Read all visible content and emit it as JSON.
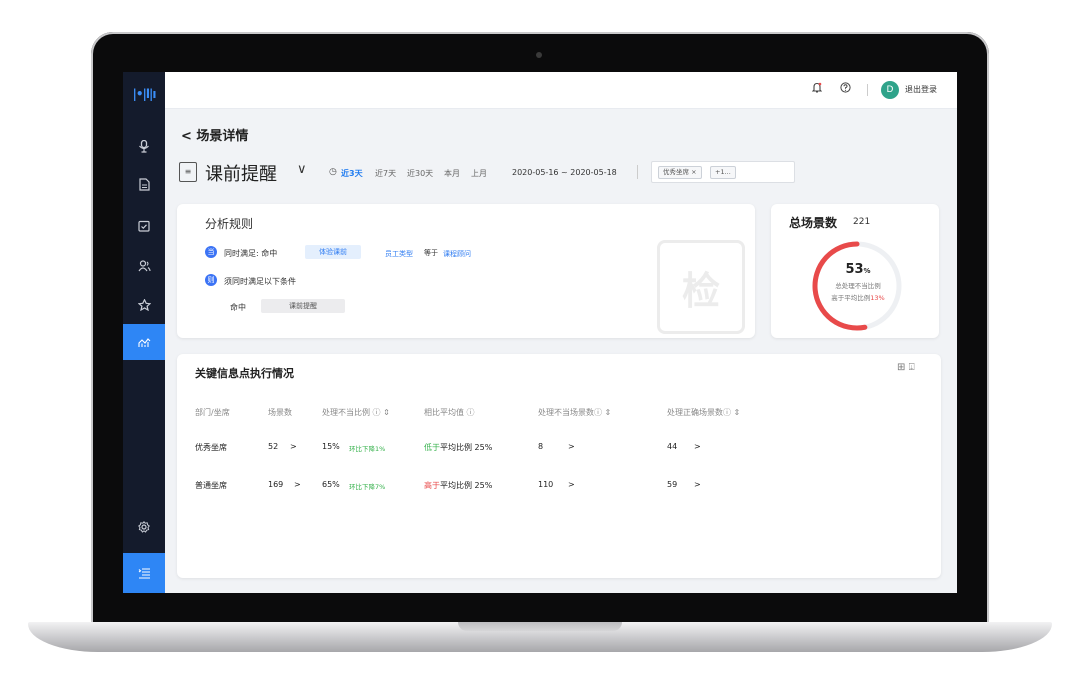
{
  "sidebar": {
    "logo": "|•|l|ı",
    "icons": [
      "microphone-icon",
      "document-icon",
      "calendar-check-icon",
      "users-icon",
      "star-icon",
      "analytics-icon",
      "settings-icon",
      "menu-list-icon"
    ]
  },
  "topbar": {
    "avatar_initial": "D",
    "logout_label": "退出登录"
  },
  "page": {
    "back_label": "场景详情",
    "title": "课前提醒",
    "ranges": [
      "近3天",
      "近7天",
      "近30天",
      "本月",
      "上月"
    ],
    "active_range": "近3天",
    "date_range": "2020-05-16 ~ 2020-05-18",
    "tags": [
      "优秀坐席 ×",
      "+1..."
    ]
  },
  "rules": {
    "title": "分析规则",
    "badge1": "当",
    "line1_text": "同时满足: 命中",
    "line1_pill": "体验课前",
    "line1_field": "员工类型",
    "line1_op": "等于",
    "line1_value": "课程顾问",
    "badge2": "则",
    "line2_text": "须同时满足以下条件",
    "line3_label": "命中",
    "line3_pill": "课前提醒",
    "stamp_char": "检"
  },
  "total": {
    "title": "总场景数",
    "count": "221",
    "percent": "53",
    "percent_unit": "%",
    "line1": "总处理不当比例",
    "line2_prefix": "高于平均比例",
    "line2_value": "13%"
  },
  "table": {
    "title": "关键信息点执行情况",
    "headers": [
      "部门/坐席",
      "场景数",
      "处理不当比例 ⓘ ⇕",
      "相比平均值 ⓘ",
      "处理不当场景数ⓘ ⇕",
      "处理正确场景数ⓘ ⇕"
    ],
    "rows": [
      {
        "name": "优秀坐席",
        "count": "52",
        "arrow1": ">",
        "ratio": "15%",
        "trend": "环比下降1%",
        "cmp_word": "低于",
        "cmp_rest": "平均比例 25%",
        "bad": "8",
        "arrow2": ">",
        "good": "44",
        "arrow3": ">"
      },
      {
        "name": "普通坐席",
        "count": "169",
        "arrow1": ">",
        "ratio": "65%",
        "trend": "环比下降7%",
        "cmp_word": "高于",
        "cmp_rest": "平均比例 25%",
        "bad": "110",
        "arrow2": ">",
        "good": "59",
        "arrow3": ">"
      }
    ]
  },
  "colors": {
    "accent": "#2e86f5",
    "sidebar_bg": "#141b2c",
    "ring_red": "#e84a4a",
    "positive": "#37b24d"
  },
  "chart_data": {
    "type": "pie",
    "values": [
      53,
      47
    ]
  }
}
